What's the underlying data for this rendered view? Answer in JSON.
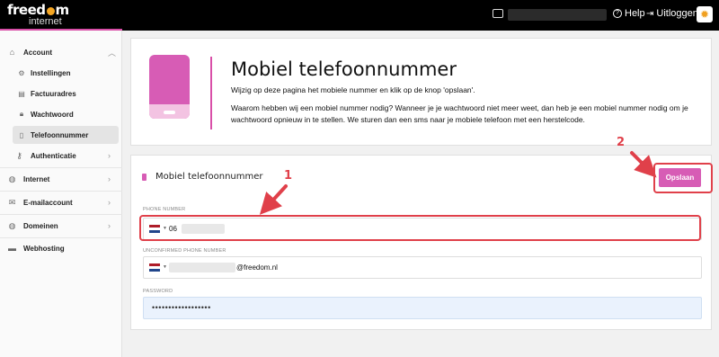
{
  "header": {
    "logo_text_left": "freed",
    "logo_text_right": "m",
    "logo_sub": "internet",
    "help_label": "Help",
    "logout_label": "Uitloggen",
    "help_icon": "question-circle-icon",
    "logout_icon": "logout-icon",
    "inbox_icon": "inbox-icon",
    "avatar_icon": "sun-icon"
  },
  "sidebar": {
    "items": [
      {
        "label": "Account",
        "icon": "home-icon"
      },
      {
        "label": "Instellingen",
        "icon": "gears-icon"
      },
      {
        "label": "Factuuradres",
        "icon": "address-card-icon"
      },
      {
        "label": "Wachtwoord",
        "icon": "lock-icon"
      },
      {
        "label": "Telefoonnummer",
        "icon": "phone-icon"
      },
      {
        "label": "Authenticatie",
        "icon": "key-icon"
      },
      {
        "label": "Internet",
        "icon": "globe-icon"
      },
      {
        "label": "E-mailaccount",
        "icon": "envelope-icon"
      },
      {
        "label": "Domeinen",
        "icon": "globe-icon"
      },
      {
        "label": "Webhosting",
        "icon": "server-icon"
      }
    ]
  },
  "info": {
    "title": "Mobiel telefoonnummer",
    "intro": "Wijzig op deze pagina het mobiele nummer en klik op de knop 'opslaan'.",
    "explanation": "Waarom hebben wij een mobiel nummer nodig? Wanneer je je wachtwoord niet meer weet, dan heb je een mobiel nummer nodig om je wachtwoord opnieuw in te stellen. We sturen dan een sms naar je mobiele telefoon met een herstelcode."
  },
  "form": {
    "section_title": "Mobiel telefoonnummer",
    "save_label": "Opslaan",
    "phone_label": "PHONE NUMBER",
    "phone_value": "06",
    "unconfirmed_label": "UNCONFIRMED PHONE NUMBER",
    "unconfirmed_suffix": "@freedom.nl",
    "password_label": "PASSWORD",
    "password_value": "••••••••••••••••••",
    "flag_colors": [
      "#ae1c28",
      "#ffffff",
      "#21468b"
    ]
  },
  "annotations": {
    "step1": "1",
    "step2": "2",
    "color": "#e0404a"
  }
}
